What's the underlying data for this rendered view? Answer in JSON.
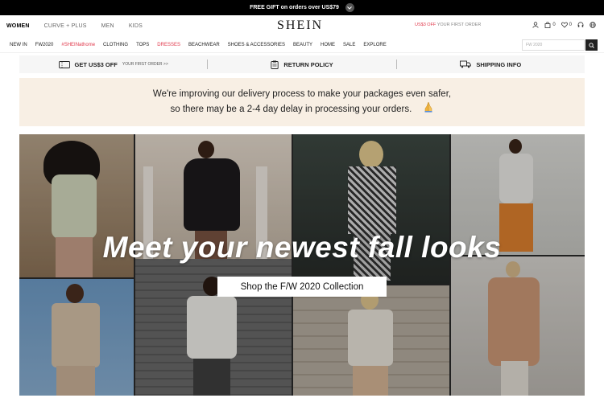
{
  "promo": {
    "text": "FREE GIFT on orders over US$79"
  },
  "header": {
    "tabs": [
      "WOMEN",
      "CURVE + PLUS",
      "MEN",
      "KIDS"
    ],
    "logo": "SHEIN",
    "promo_red": "US$3 OFF",
    "promo_rest": " YOUR FIRST ORDER",
    "bag_count": "0",
    "wish_count": "0"
  },
  "nav": {
    "items": [
      "NEW IN",
      "FW2020",
      "#SHEINathome",
      "CLOTHING",
      "TOPS",
      "DRESSES",
      "BEACHWEAR",
      "SHOES & ACCESSORIES",
      "BEAUTY",
      "HOME",
      "SALE",
      "EXPLORE"
    ],
    "search_placeholder": "FW 2020"
  },
  "info": {
    "offer_label": "GET US$3 OFF",
    "offer_sub": "YOUR FIRST ORDER >>",
    "return_label": "RETURN POLICY",
    "shipping_label": "SHIPPING INFO"
  },
  "notice": {
    "line1": "We're improving our delivery process to make your packages even safer,",
    "line2": "so there may be a 2-4 day delay in processing your orders."
  },
  "hero": {
    "title": "Meet your newest fall looks",
    "cta": "Shop the F/W 2020 Collection"
  },
  "colors": {
    "accent_red": "#e0384b",
    "notice_bg": "#f8efe4"
  }
}
